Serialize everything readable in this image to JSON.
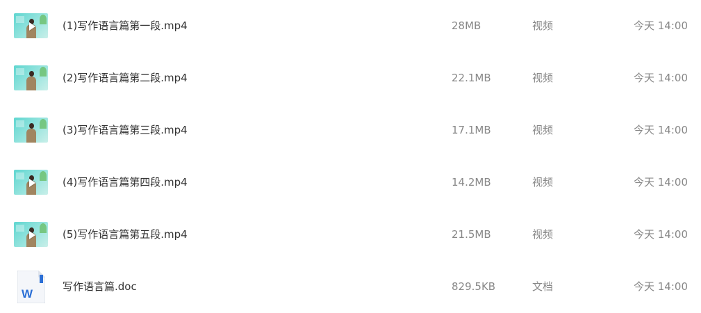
{
  "files": [
    {
      "name": "(1)写作语言篇第一段.mp4",
      "size": "28MB",
      "type": "视频",
      "time": "今天 14:00",
      "icon": "video-thumbnail-icon",
      "has_play": true
    },
    {
      "name": "(2)写作语言篇第二段.mp4",
      "size": "22.1MB",
      "type": "视频",
      "time": "今天 14:00",
      "icon": "video-thumbnail-icon",
      "has_play": false
    },
    {
      "name": "(3)写作语言篇第三段.mp4",
      "size": "17.1MB",
      "type": "视频",
      "time": "今天 14:00",
      "icon": "video-thumbnail-icon",
      "has_play": false
    },
    {
      "name": "(4)写作语言篇第四段.mp4",
      "size": "14.2MB",
      "type": "视频",
      "time": "今天 14:00",
      "icon": "video-thumbnail-icon",
      "has_play": true
    },
    {
      "name": "(5)写作语言篇第五段.mp4",
      "size": "21.5MB",
      "type": "视频",
      "time": "今天 14:00",
      "icon": "video-thumbnail-icon",
      "has_play": true
    },
    {
      "name": "写作语言篇.doc",
      "size": "829.5KB",
      "type": "文档",
      "time": "今天 14:00",
      "icon": "word-document-icon",
      "has_play": false
    }
  ],
  "colors": {
    "name_text": "#333333",
    "meta_text": "#888888",
    "word_blue": "#2b6fd6"
  }
}
